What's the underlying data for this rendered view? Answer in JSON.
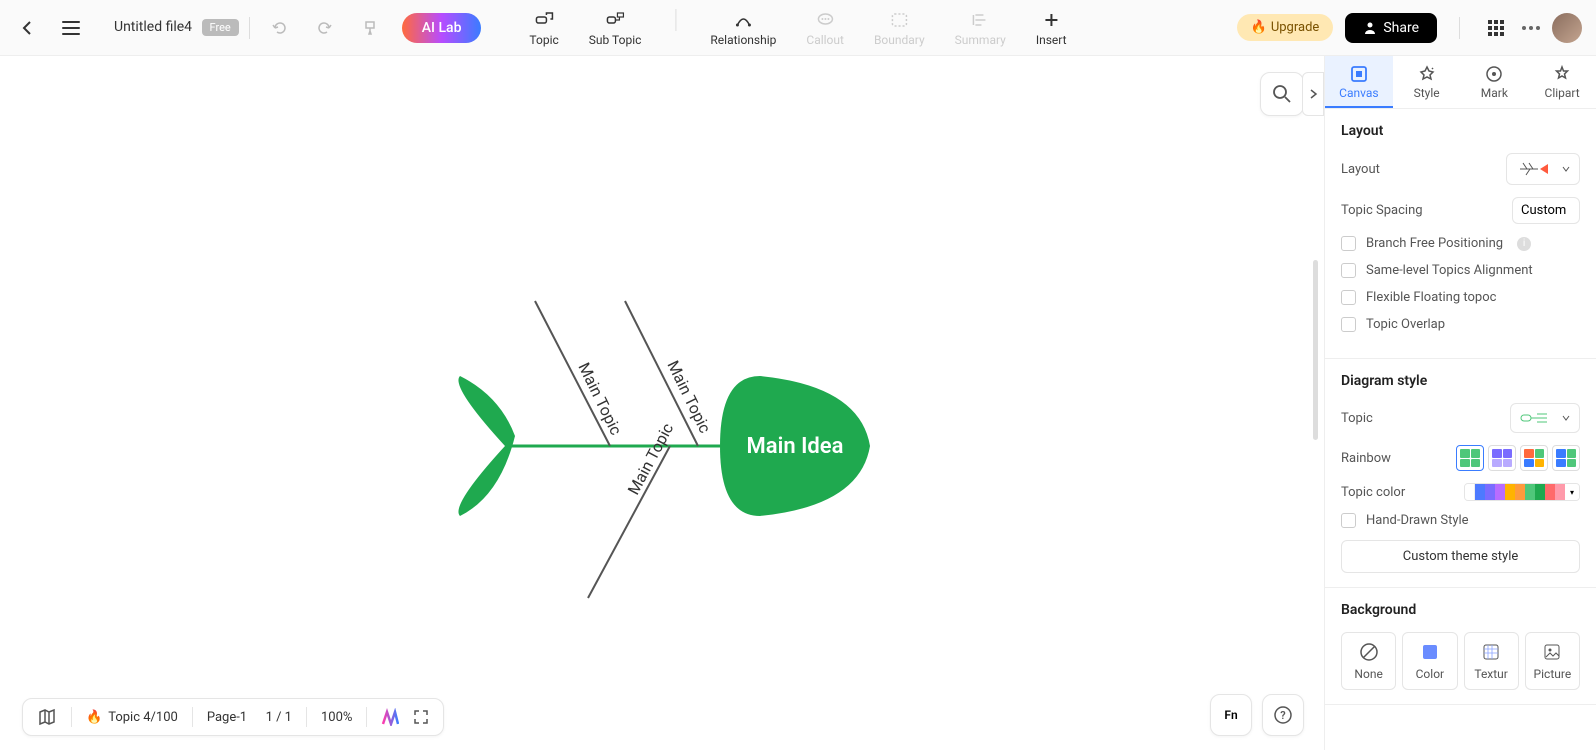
{
  "header": {
    "file_name": "Untitled file4",
    "free_badge": "Free",
    "ai_lab": "AI Lab",
    "upgrade": "Upgrade",
    "share": "Share"
  },
  "tools": {
    "topic": "Topic",
    "subtopic": "Sub Topic",
    "relationship": "Relationship",
    "callout": "Callout",
    "boundary": "Boundary",
    "summary": "Summary",
    "insert": "Insert"
  },
  "panel_tabs": {
    "canvas": "Canvas",
    "style": "Style",
    "mark": "Mark",
    "clipart": "Clipart"
  },
  "layout_section": {
    "title": "Layout",
    "layout_label": "Layout",
    "spacing_label": "Topic Spacing",
    "spacing_value": "Custom",
    "branch_free": "Branch Free Positioning",
    "same_level": "Same-level Topics Alignment",
    "flexible": "Flexible Floating topoc",
    "overlap": "Topic Overlap"
  },
  "diagram_section": {
    "title": "Diagram style",
    "topic_label": "Topic",
    "rainbow_label": "Rainbow",
    "topic_color_label": "Topic color",
    "hand_drawn": "Hand-Drawn Style",
    "custom_theme": "Custom theme style"
  },
  "bg_section": {
    "title": "Background",
    "none": "None",
    "color": "Color",
    "texture": "Textur",
    "picture": "Picture"
  },
  "bottom": {
    "topic_count": "Topic 4/100",
    "page": "Page-1",
    "page_num": "1 / 1",
    "zoom": "100%"
  },
  "diagram": {
    "main_idea": "Main Idea",
    "branch1": "Main Topic",
    "branch2": "Main Topic",
    "branch3": "Main Topic"
  },
  "colors": {
    "green": "#1fa94f",
    "accent": "#3a7cff"
  }
}
